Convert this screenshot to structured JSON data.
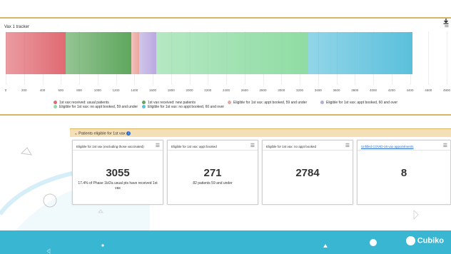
{
  "chart": {
    "title": "Vax 1 tracker",
    "ticks": [
      "0",
      "200",
      "400",
      "600",
      "800",
      "1000",
      "1200",
      "1400",
      "1600",
      "1800",
      "2000",
      "2200",
      "2400",
      "2600",
      "2800",
      "3000",
      "3200",
      "3400",
      "3600",
      "3800",
      "4000",
      "4200",
      "4400",
      "4600",
      "4800"
    ]
  },
  "chart_data": {
    "type": "bar",
    "orientation": "horizontal",
    "stacked": true,
    "xlim": [
      0,
      4800
    ],
    "series": [
      {
        "name": "1st vax received: usual patients",
        "value": 650,
        "color": "#e06a73"
      },
      {
        "name": "1st vax received: new patients",
        "value": 720,
        "color": "#5fa75e"
      },
      {
        "name": "Eligible for 1st vax: appt booked, 59 and under",
        "value": 80,
        "color": "#eba69c"
      },
      {
        "name": "Eligible for 1st vax: appt booked, 60 and over",
        "value": 191,
        "color": "#b9a9e0"
      },
      {
        "name": "Eligible for 1st vax: no appt booked, 59 and under",
        "value": 1650,
        "color": "#8fdca4"
      },
      {
        "name": "Eligible for 1st vax: no appt booked, 60 and over",
        "value": 1134,
        "color": "#5bc0dc"
      }
    ],
    "legend": [
      {
        "label": "1st vax received: usual patients",
        "color": "#e06a73"
      },
      {
        "label": "1st vax received: new patients",
        "color": "#5fa75e"
      },
      {
        "label": "Eligible for 1st vax: appt booked, 59 and under",
        "color": "#eba69c"
      },
      {
        "label": "Eligible for 1st vax: appt booked, 60 and over",
        "color": "#b9a9e0"
      },
      {
        "label": "Eligible for 1st vax: no appt booked, 59 and under",
        "color": "#8fdca4"
      },
      {
        "label": "Eligible for 1st vax: no appt booked, 60 and over",
        "color": "#5bc0dc"
      }
    ]
  },
  "section": {
    "title": "Patients eligible for 1st vax"
  },
  "kpis": [
    {
      "title": "Eligible for 1st vax (excluding those vaccinated)",
      "value": "3055",
      "sub": "17.4% of Phase 1b/2a usual pts have received 1st vax"
    },
    {
      "title": "Eligible for 1st vax: appt booked",
      "value": "271",
      "sub": "82 patients 59 and under"
    },
    {
      "title": "Eligible for 1st vax: no appt booked",
      "value": "2784",
      "sub": ""
    },
    {
      "title": "Unfilled COVID-19 vax appointments",
      "value": "8",
      "sub": ""
    }
  ],
  "footer": {
    "logo_text": "Cubiko"
  },
  "colors": {
    "accent": "#d9b462",
    "footer": "#38b6d2",
    "section_bg": "#f4dfb6"
  }
}
